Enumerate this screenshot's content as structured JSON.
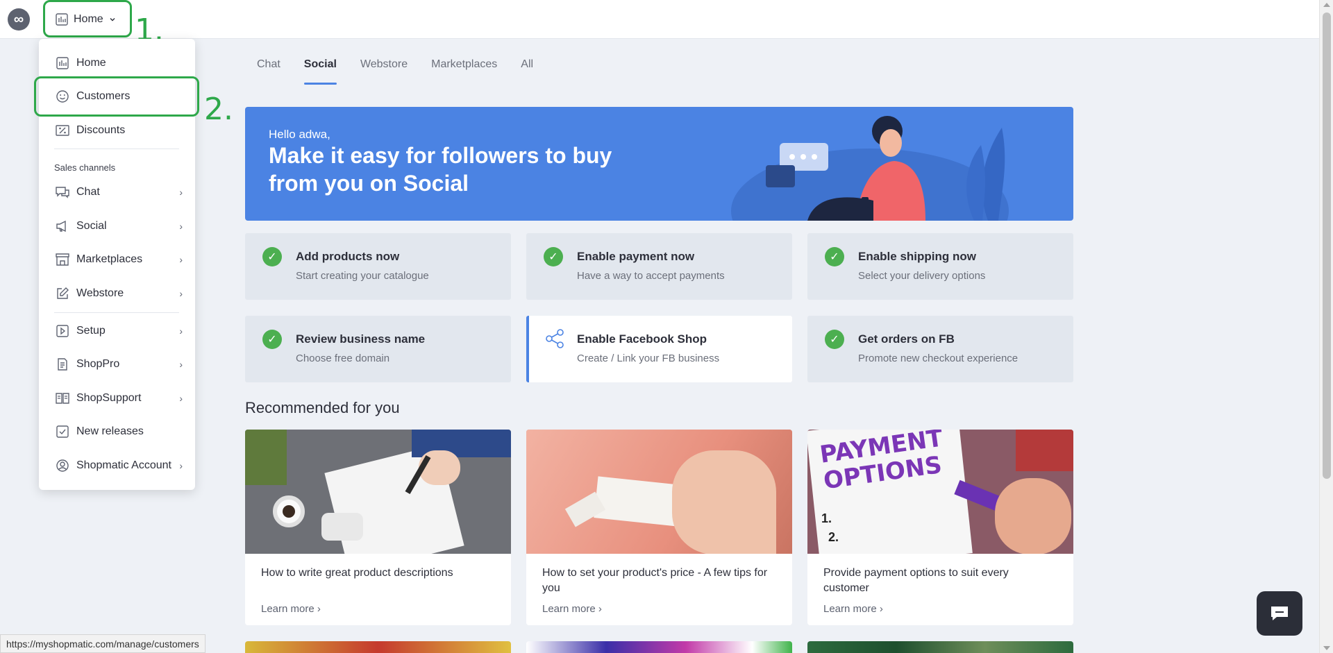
{
  "header": {
    "logo_symbol": "∞",
    "home_button_label": "Home"
  },
  "annotations": {
    "step1": "1.",
    "step2": "2."
  },
  "menu": {
    "top_items": [
      {
        "label": "Home",
        "icon": "bar-chart-icon"
      },
      {
        "label": "Customers",
        "icon": "smiley-icon"
      },
      {
        "label": "Discounts",
        "icon": "discount-icon"
      }
    ],
    "section_label": "Sales channels",
    "channel_items": [
      {
        "label": "Chat",
        "icon": "chat-icon"
      },
      {
        "label": "Social",
        "icon": "megaphone-icon"
      },
      {
        "label": "Marketplaces",
        "icon": "store-icon"
      },
      {
        "label": "Webstore",
        "icon": "edit-icon"
      }
    ],
    "other_items": [
      {
        "label": "Setup",
        "icon": "play-icon"
      },
      {
        "label": "ShopPro",
        "icon": "document-icon"
      },
      {
        "label": "ShopSupport",
        "icon": "book-icon"
      },
      {
        "label": "New releases",
        "icon": "checkbox-icon"
      },
      {
        "label": "Shopmatic Account",
        "icon": "user-circle-icon"
      }
    ]
  },
  "tabs": [
    "Chat",
    "Social",
    "Webstore",
    "Marketplaces",
    "All"
  ],
  "active_tab": "Social",
  "banner": {
    "greeting": "Hello adwa,",
    "headline": "Make it easy for followers to buy from you on Social"
  },
  "tasks": [
    {
      "title": "Add products now",
      "subtitle": "Start creating your catalogue",
      "done": true
    },
    {
      "title": "Enable payment now",
      "subtitle": "Have a way to accept payments",
      "done": true
    },
    {
      "title": "Enable shipping now",
      "subtitle": "Select your delivery options",
      "done": true
    },
    {
      "title": "Review business name",
      "subtitle": "Choose free domain",
      "done": true
    },
    {
      "title": "Enable Facebook Shop",
      "subtitle": "Create / Link your FB business",
      "done": false
    },
    {
      "title": "Get orders on FB",
      "subtitle": "Promote new checkout experience",
      "done": true
    }
  ],
  "recommended": {
    "heading": "Recommended for you",
    "cards": [
      {
        "title": "How to write great product descriptions",
        "link": "Learn more ›"
      },
      {
        "title": "How to set your product's price - A few tips for you",
        "link": "Learn more ›"
      },
      {
        "title": "Provide payment options to suit every customer",
        "link": "Learn more ›"
      }
    ],
    "card3_image_text": "PAYMENT OPTIONS",
    "card3_list_marks": [
      "1.",
      "2."
    ]
  },
  "status_bar": {
    "url": "https://myshopmatic.com/manage/customers"
  },
  "colors": {
    "accent": "#4b83e3",
    "annotation_green": "#2ea84a",
    "check_green": "#4caf50",
    "page_bg": "#eef1f6"
  }
}
